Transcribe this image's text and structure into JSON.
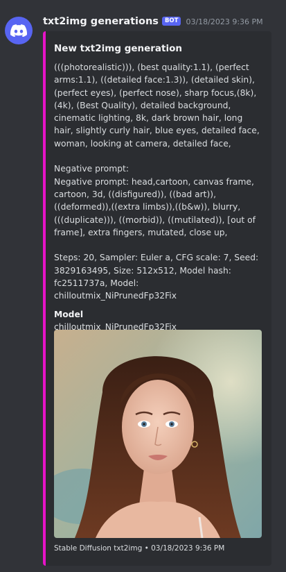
{
  "message": {
    "author": "txt2img generations",
    "bot_tag": "BOT",
    "timestamp": "03/18/2023 9:36 PM",
    "avatar_icon": "discord-logo-icon",
    "avatar_color": "#5865f2"
  },
  "embed": {
    "accent_color": "#e614c8",
    "title": "New txt2img generation",
    "description": "(((photorealistic))), (best quality:1.1), (perfect arms:1.1), ((detailed face:1.3)), (detailed skin), (perfect eyes), (perfect nose), sharp focus,(8k), (4k), (Best Quality), detailed background, cinematic lighting, 8k, dark brown hair, long hair, slightly curly hair, blue eyes, detailed face, woman, looking at camera, detailed face,\n\nNegative prompt:\nNegative prompt: head,cartoon, canvas frame, cartoon, 3d, ((disfigured)), ((bad art)), ((deformed)),((extra limbs)),((b&w)), blurry, (((duplicate))), ((morbid)), ((mutilated)), [out of frame], extra fingers, mutated, close up,\n\nSteps: 20, Sampler: Euler a, CFG scale: 7, Seed: 3829163495, Size: 512x512, Model hash: fc2511737a, Model: chilloutmix_NiPrunedFp32Fix",
    "field": {
      "name": "Model",
      "value": "chilloutmix_NiPrunedFp32Fix"
    },
    "image_icon": "generated-portrait-image",
    "footer": "Stable Diffusion txt2img • 03/18/2023 9:36 PM"
  }
}
